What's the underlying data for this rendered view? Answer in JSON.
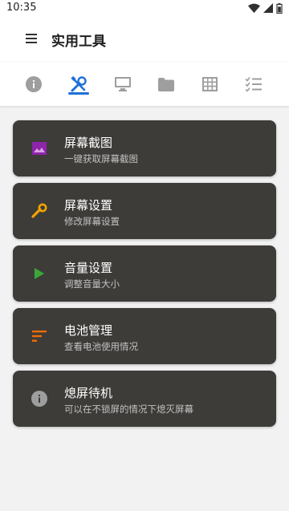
{
  "status_bar": {
    "time": "10:35",
    "icons": [
      "wifi-icon",
      "signal-icon",
      "battery-icon"
    ]
  },
  "app_bar": {
    "title": "实用工具",
    "menu_icon": "menu-icon"
  },
  "tabs": [
    {
      "icon": "info-icon",
      "selected": false
    },
    {
      "icon": "tools-icon",
      "selected": true
    },
    {
      "icon": "monitor-icon",
      "selected": false
    },
    {
      "icon": "folder-icon",
      "selected": false
    },
    {
      "icon": "grid-icon",
      "selected": false
    },
    {
      "icon": "checklist-icon",
      "selected": false
    }
  ],
  "colors": {
    "accent": "#1e6fd9",
    "tab_icon": "#9e9e9e",
    "card_bg": "#3e3c39"
  },
  "cards": [
    {
      "title": "屏幕截图",
      "subtitle": "一键获取屏幕截图",
      "icon": "image-icon",
      "icon_color": "#8e24aa"
    },
    {
      "title": "屏幕设置",
      "subtitle": "修改屏幕设置",
      "icon": "wrench-icon",
      "icon_color": "#f2a300"
    },
    {
      "title": "音量设置",
      "subtitle": "调整音量大小",
      "icon": "play-icon",
      "icon_color": "#3aa83a"
    },
    {
      "title": "电池管理",
      "subtitle": "查看电池使用情况",
      "icon": "sort-lines-icon",
      "icon_color": "#ef6c00"
    },
    {
      "title": "熄屏待机",
      "subtitle": "可以在不锁屏的情况下熄灭屏幕",
      "icon": "info-icon",
      "icon_color": "#9e9e9e"
    }
  ]
}
